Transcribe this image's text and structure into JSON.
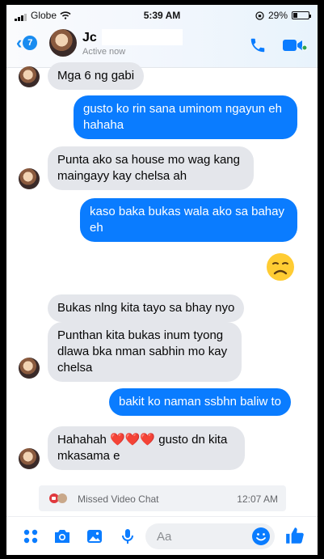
{
  "status_bar": {
    "carrier": "Globe",
    "time": "5:39 AM",
    "battery": "29%",
    "battery_level": 0.29
  },
  "header": {
    "back_count": "7",
    "name": "Jc",
    "subtitle": "Active now",
    "call_icon": "phone-icon",
    "video_icon": "video-camera-icon"
  },
  "messages": [
    {
      "from": "them",
      "text": "Mga 6 ng gabi"
    },
    {
      "from": "me",
      "text": "gusto ko rin sana uminom ngayun eh hahaha"
    },
    {
      "from": "them",
      "text": "Punta ako sa house mo wag kang maingayy kay chelsa ah"
    },
    {
      "from": "me",
      "text": "kaso baka bukas wala ako sa bahay eh"
    },
    {
      "from": "me",
      "emoji": "disappointed-face"
    },
    {
      "from": "them",
      "text": "Bukas nlng kita tayo sa bhay nyo"
    },
    {
      "from": "them",
      "text": "Punthan kita bukas inum tyong dlawa bka nman sabhin mo kay chelsa"
    },
    {
      "from": "me",
      "text": "bakit ko naman ssbhn baliw to"
    },
    {
      "from": "them",
      "text": "Hahahah ❤️❤️❤️ gusto dn kita mkasama e"
    }
  ],
  "missed_call": {
    "label": "Missed Video Chat",
    "time": "12:07 AM"
  },
  "composer": {
    "placeholder": "Aa",
    "icons": [
      "menu-dots-icon",
      "camera-icon",
      "gallery-icon",
      "microphone-icon",
      "emoji-icon",
      "like-icon"
    ]
  },
  "colors": {
    "accent": "#0A7CFF",
    "incoming_bubble": "#E4E6EB",
    "active_dot": "#31A24C"
  }
}
